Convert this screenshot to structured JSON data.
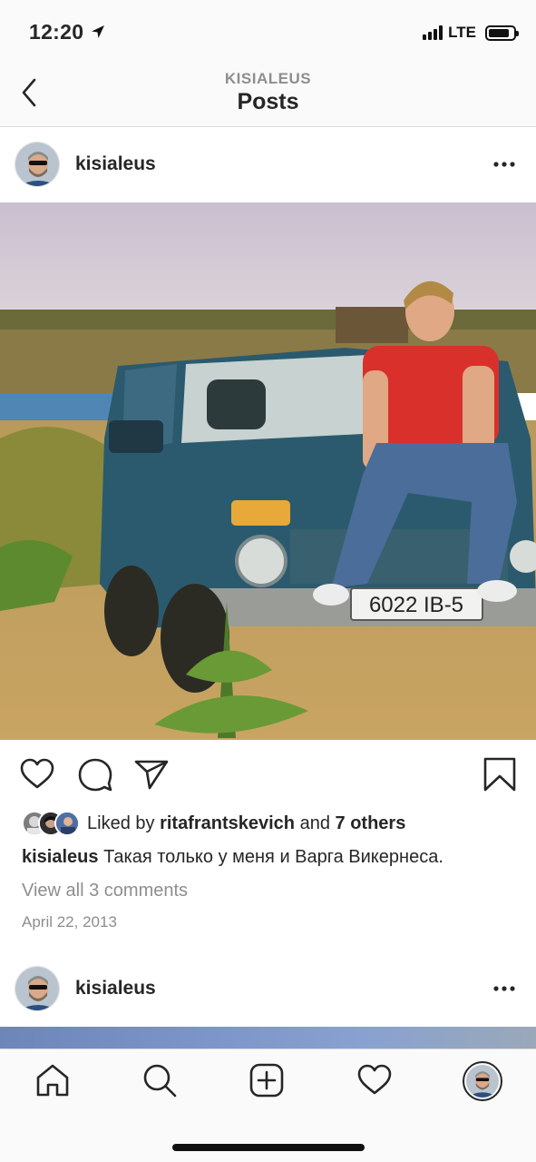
{
  "status_bar": {
    "time": "12:20",
    "network": "LTE",
    "signal_bars": 4,
    "battery_level": 0.85,
    "icons": [
      "location-arrow-icon",
      "signal-icon",
      "battery-icon"
    ]
  },
  "header": {
    "subtitle": "KISIALEUS",
    "title": "Posts",
    "back_icon": "chevron-left-icon"
  },
  "post": {
    "username": "kisialeus",
    "more_icon": "more-horizontal-icon",
    "actions": [
      "heart-icon",
      "comment-icon",
      "share-icon",
      "bookmark-icon"
    ],
    "likes_prefix": "Liked by",
    "liked_by_user": "ritafrantskevich",
    "likes_and": "and",
    "likes_others": "7 others",
    "caption_user": "kisialeus",
    "caption_text": "Такая только у меня и Варга Викернеса.",
    "view_comments": "View all 3 comments",
    "date": "April 22, 2013",
    "license_plate": "6022 IB-5"
  },
  "next_post": {
    "username": "kisialeus",
    "more_icon": "more-horizontal-icon"
  },
  "tab_bar": {
    "items": [
      "home-icon",
      "search-icon",
      "new-post-icon",
      "activity-heart-icon",
      "profile-avatar"
    ]
  },
  "colors": {
    "text": "#262626",
    "secondary": "#8e8e8e",
    "border": "#dbdbdb",
    "bar_bg": "#fafafa"
  }
}
